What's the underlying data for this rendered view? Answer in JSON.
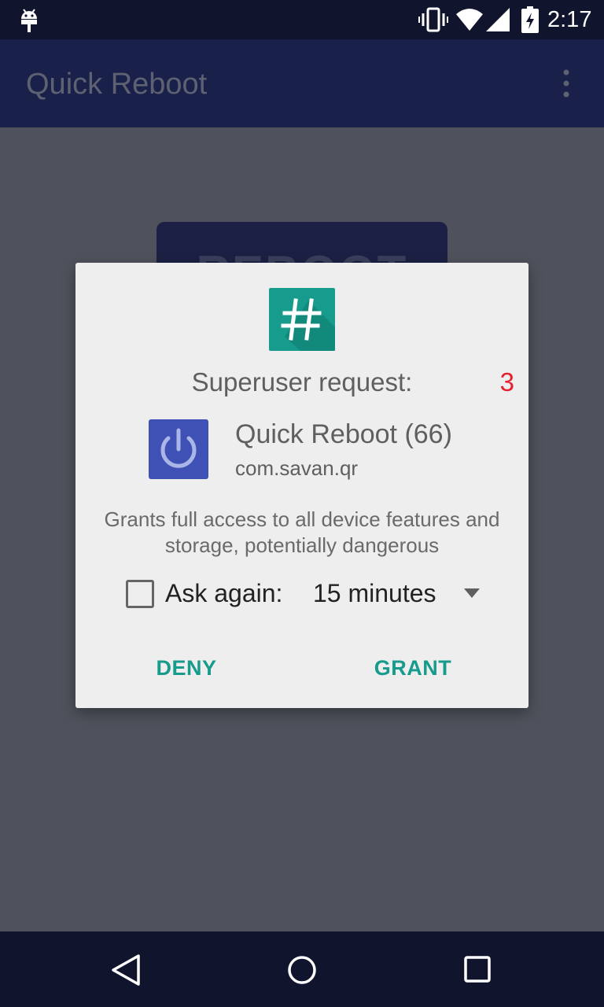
{
  "status_bar": {
    "time": "2:17",
    "icons": [
      "android-debug-icon",
      "vibrate-icon",
      "wifi-icon",
      "cell-signal-icon",
      "battery-charging-icon"
    ]
  },
  "app_bar": {
    "title": "Quick Reboot",
    "menu_icon": "overflow-menu-icon"
  },
  "background": {
    "reboot_button_label": "REBOOT"
  },
  "dialog": {
    "icon": "superuser-hash-icon",
    "title": "Superuser request:",
    "countdown": "3",
    "app_icon": "power-icon",
    "app_name": "Quick Reboot (66)",
    "app_package": "com.savan.qr",
    "description": "Grants full access to all device features and storage, potentially dangerous",
    "ask_again_label": "Ask again:",
    "ask_again_checked": false,
    "duration_value": "15 minutes",
    "deny_label": "DENY",
    "grant_label": "GRANT"
  },
  "nav_bar": {
    "icons": [
      "back-icon",
      "home-icon",
      "recents-icon"
    ]
  },
  "colors": {
    "status_bar": "#11142d",
    "app_bar": "#192049",
    "scrim_background": "#4f525c",
    "dialog_background": "#eeeeee",
    "accent": "#169b8c",
    "countdown": "#e5202e",
    "app_icon_background": "#3f51b5",
    "su_icon_background": "#169b8c"
  }
}
